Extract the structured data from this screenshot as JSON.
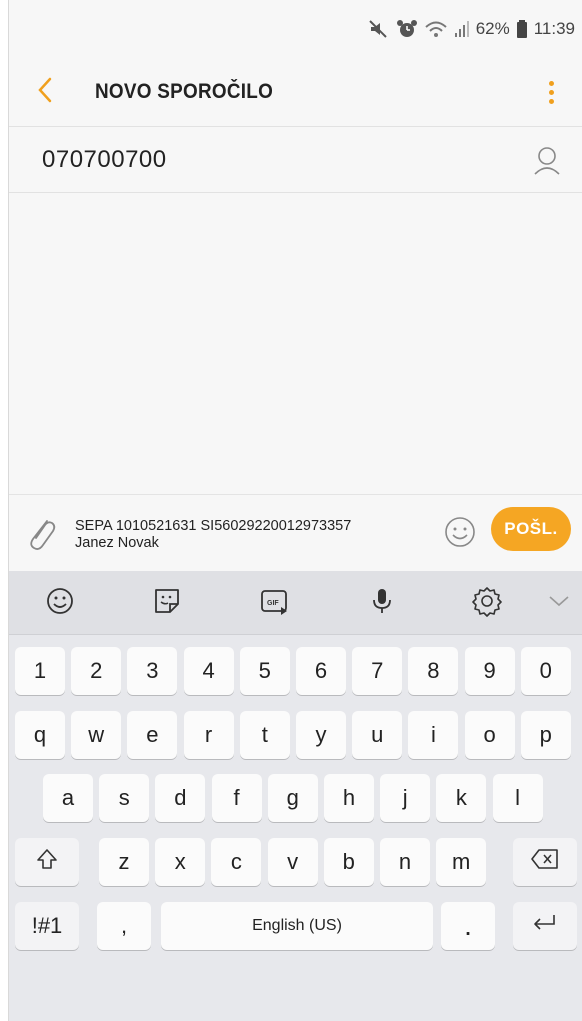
{
  "status_bar": {
    "battery_pct": "62%",
    "time": "11:39"
  },
  "app_bar": {
    "title": "NOVO SPOROČILO"
  },
  "recipient": {
    "number": "070700700"
  },
  "composer": {
    "message": "SEPA 1010521631 SI56029220012973357\nJanez Novak",
    "send_label": "POŠL."
  },
  "keyboard": {
    "row_numbers": [
      "1",
      "2",
      "3",
      "4",
      "5",
      "6",
      "7",
      "8",
      "9",
      "0"
    ],
    "row_top": [
      "q",
      "w",
      "e",
      "r",
      "t",
      "y",
      "u",
      "i",
      "o",
      "p"
    ],
    "row_home": [
      "a",
      "s",
      "d",
      "f",
      "g",
      "h",
      "j",
      "k",
      "l"
    ],
    "row_bottom": [
      "z",
      "x",
      "c",
      "v",
      "b",
      "n",
      "m"
    ],
    "symbols_label": "!#1",
    "comma_label": ",",
    "space_label": "English (US)",
    "period_label": "."
  },
  "colors": {
    "accent": "#f5a623",
    "keyboard_bg": "#e7e8ec",
    "key_bg": "#fbfbfb"
  },
  "icons": [
    "mute-icon",
    "alarm-icon",
    "wifi-icon",
    "signal-icon",
    "battery-icon",
    "back-chevron-icon",
    "more-vert-icon",
    "contact-icon",
    "paperclip-icon",
    "emoji-icon",
    "sticker-icon",
    "gif-icon",
    "mic-icon",
    "settings-icon",
    "chevron-down-icon",
    "shift-icon",
    "backspace-icon",
    "enter-icon"
  ]
}
